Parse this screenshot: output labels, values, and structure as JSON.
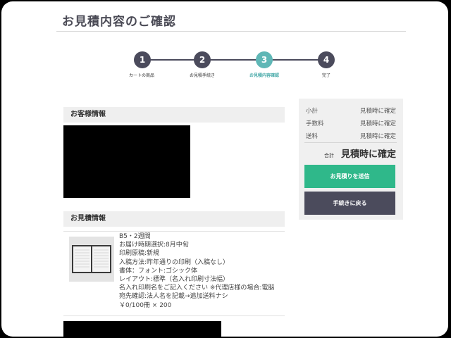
{
  "page": {
    "title": "お見積内容のご確認"
  },
  "steps": [
    {
      "number": "1",
      "label": "カートの商品",
      "active": false
    },
    {
      "number": "2",
      "label": "お見積手続き",
      "active": false
    },
    {
      "number": "3",
      "label": "お見積内容確認",
      "active": true
    },
    {
      "number": "4",
      "label": "完了",
      "active": false
    }
  ],
  "customer": {
    "heading": "お客様情報"
  },
  "estimate": {
    "heading": "お見積情報",
    "item": {
      "lines": [
        "B5・2週間",
        "お届け時期選択:8月中旬",
        "印刷原稿:新規",
        "入稿方法:昨年通りの印刷（入稿なし）",
        "書体：フォント:ゴシック体",
        "レイアウト:標準（名入れ印刷寸法幅）",
        "名入れ印刷名をご記入ください ※代理店様の場合:電脳",
        "宛先確認:法人名を記載→追加送料ナシ",
        "￥0/100冊 × 200"
      ]
    }
  },
  "summary": {
    "subtotal_label": "小計",
    "subtotal_value": "見積時に確定",
    "fee_label": "手数料",
    "fee_value": "見積時に確定",
    "shipping_label": "送料",
    "shipping_value": "見積時に確定",
    "total_label": "合計",
    "total_value": "見積時に確定",
    "send_button": "お見積りを送信",
    "back_button": "手続きに戻る"
  },
  "colors": {
    "accent": "#5fb7b6",
    "primary": "#4b4b5c",
    "send": "#2fb88a"
  }
}
